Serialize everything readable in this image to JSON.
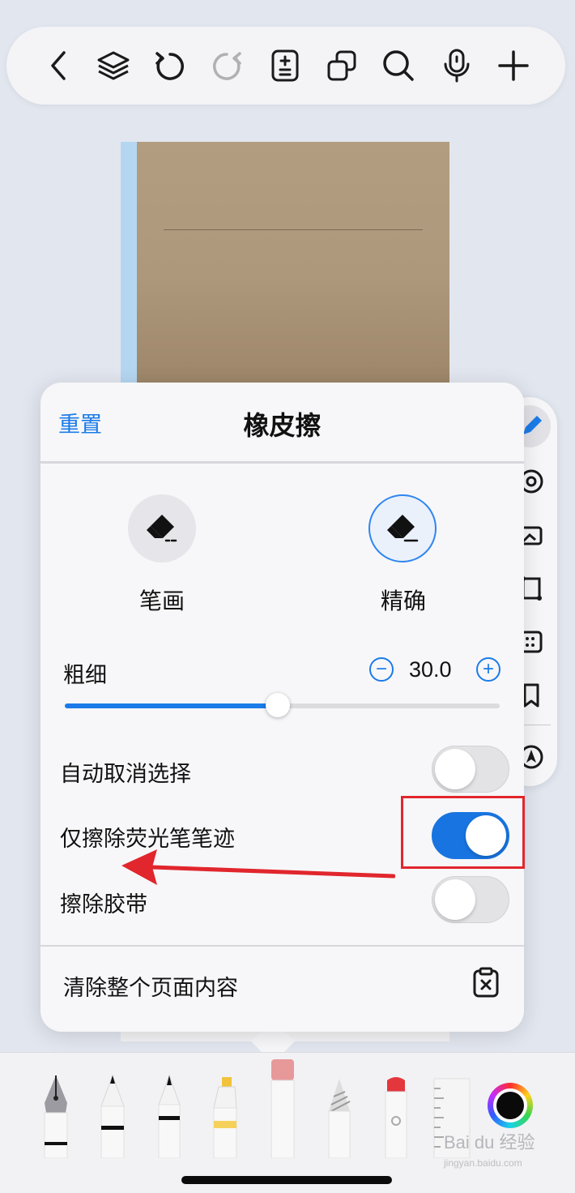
{
  "toolbar": {
    "buttons": [
      "back",
      "layers",
      "undo",
      "redo",
      "page-add",
      "duplicate",
      "search",
      "microphone",
      "add"
    ]
  },
  "panel": {
    "reset_label": "重置",
    "title": "橡皮擦",
    "modes": [
      {
        "label": "笔画",
        "icon": "stroke-eraser-icon",
        "selected": false
      },
      {
        "label": "精确",
        "icon": "precise-eraser-icon",
        "selected": true
      }
    ],
    "thickness": {
      "label": "粗细",
      "value": "30.0",
      "slider_fraction": 0.49,
      "decrement_symbol": "−",
      "increment_symbol": "+"
    },
    "toggles": [
      {
        "label": "自动取消选择",
        "on": false
      },
      {
        "label": "仅擦除荧光笔笔迹",
        "on": true
      },
      {
        "label": "擦除胶带",
        "on": false
      }
    ],
    "clear_page_label": "清除整个页面内容"
  },
  "colors": {
    "accent": "#1b7be8",
    "toggle_on": "#1874e0",
    "annotation_red": "#e1262d"
  },
  "tray": {
    "tools": [
      "fountain-pen",
      "ballpoint-pen",
      "pencil",
      "highlighter",
      "eraser",
      "marker",
      "tape",
      "ruler"
    ],
    "current_color": "#0a0a0a"
  },
  "watermark": {
    "text": "Bai du 经验",
    "subtext": "jingyan.baidu.com"
  }
}
